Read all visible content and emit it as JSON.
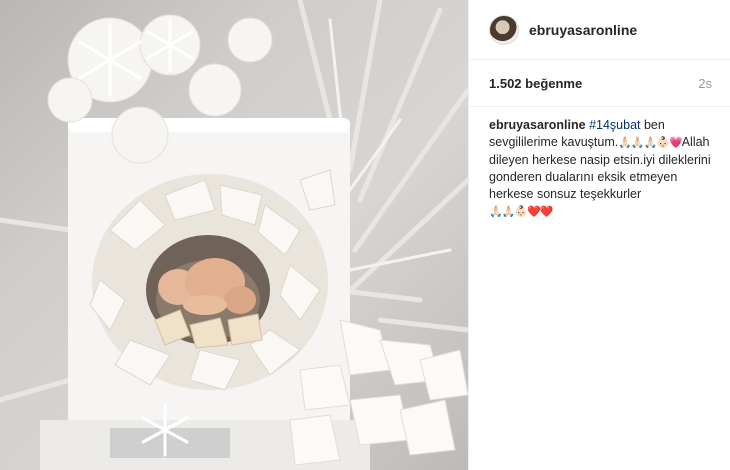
{
  "post": {
    "username": "ebruyasaronline",
    "likes": "1.502 beğenme",
    "time": "2s"
  },
  "caption": {
    "username": "ebruyasaronline",
    "hashtag": "#14şubat",
    "line1_rest": " ben sevgililerime kavuştum.",
    "emoji1": "🙏🏻🙏🏻🙏🏻👶🏻💗",
    "line2": "Allah dileyen herkese nasip etsin.iyi dileklerini gonderen dualarını eksik etmeyen herkese sonsuz teşekkurler",
    "emoji2": "🙏🏻🙏🏻👶🏻❤️❤️"
  },
  "icons": {
    "avatar": "profile-avatar",
    "photo": "winter-cake-photo"
  }
}
